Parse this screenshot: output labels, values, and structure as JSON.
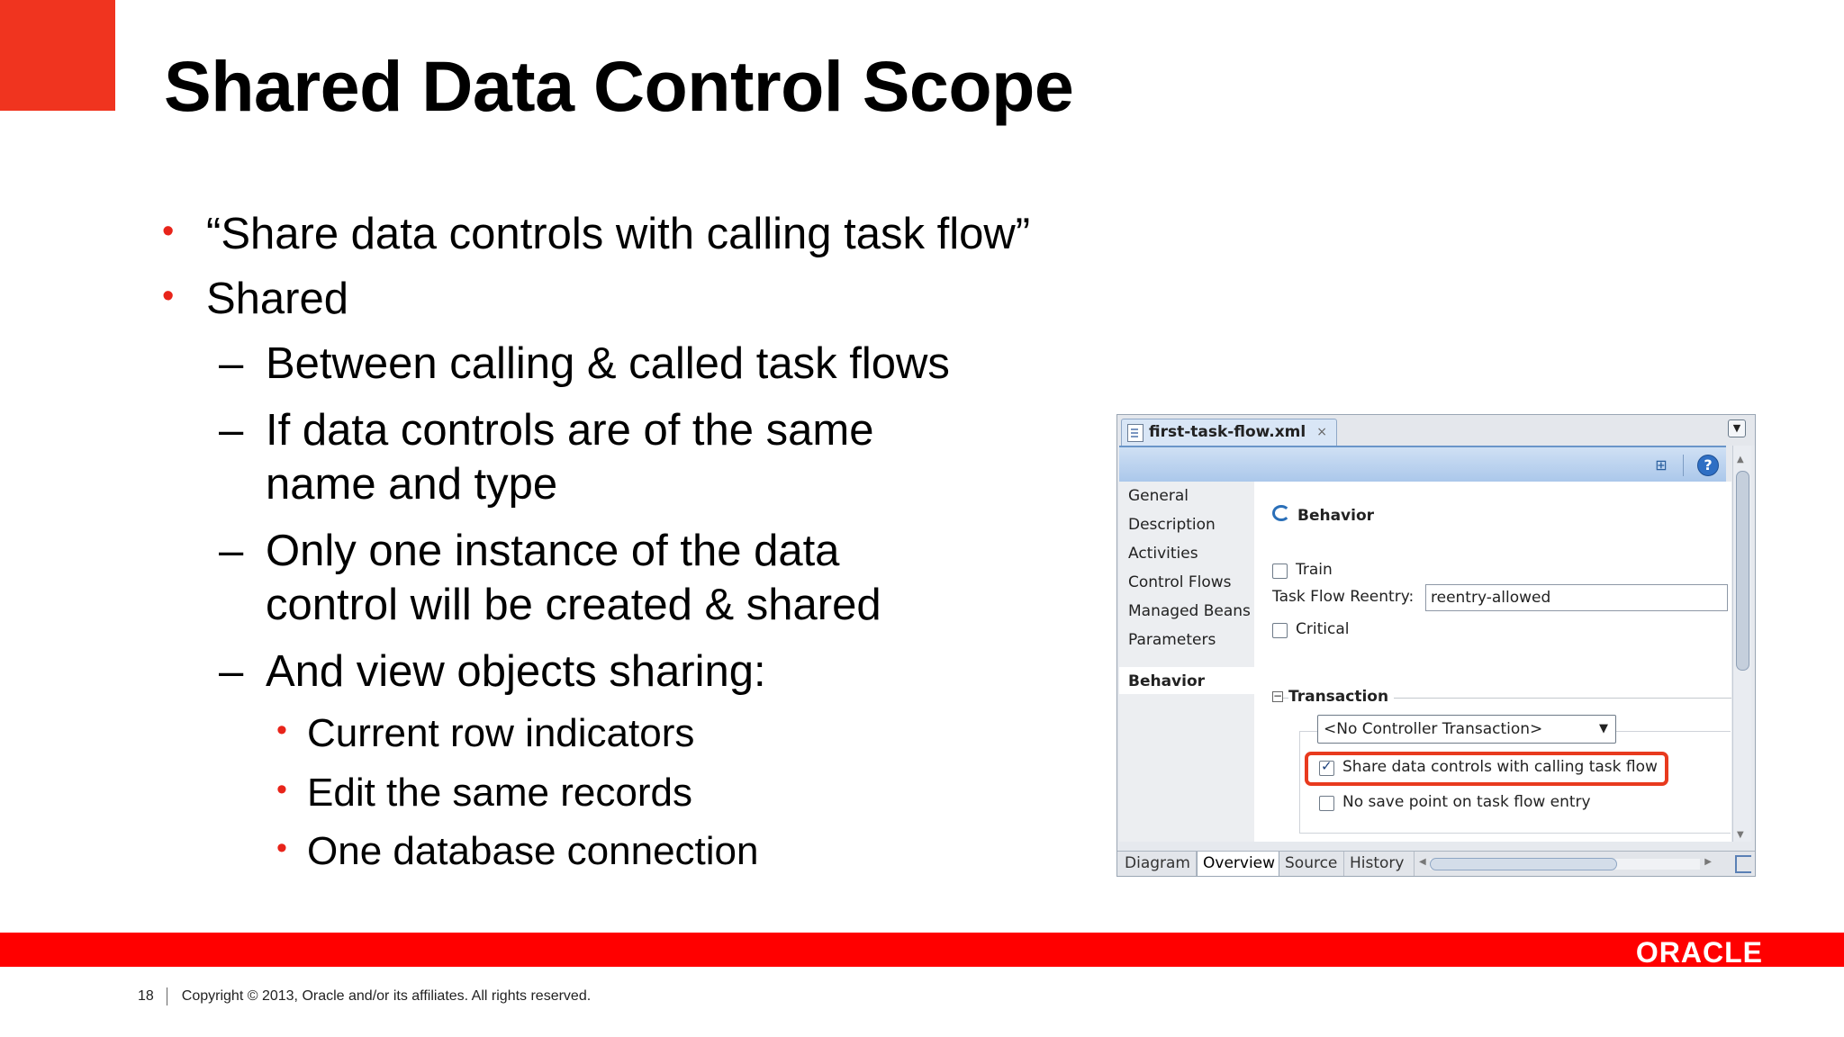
{
  "slide": {
    "title": "Shared Data Control Scope",
    "bullets": {
      "b1": "“Share data controls with calling task flow”",
      "b2": "Shared",
      "s1": "Between calling & called task flows",
      "s2": "If data controls are of the same name and type",
      "s3": "Only one instance of the data control will be created & shared",
      "s4": "And view objects sharing:",
      "t1": "Current row indicators",
      "t2": "Edit the same records",
      "t3": "One database connection"
    },
    "bullet_glyph": "•",
    "dash_glyph": "–",
    "page_number": "18",
    "copyright": "Copyright © 2013, Oracle and/or its affiliates. All rights reserved.",
    "logo": "ORACLE",
    "colors": {
      "accent": "#f0341f",
      "bar": "#ff0000",
      "bullet": "#e8241a"
    }
  },
  "ide": {
    "file_tab": "first-task-flow.xml",
    "tab_close": "×",
    "nav": [
      "General",
      "Description",
      "Activities",
      "Control Flows",
      "Managed Beans",
      "Parameters",
      "Behavior"
    ],
    "section_title": "Behavior",
    "train_label": "Train",
    "reentry_label": "Task Flow Reentry:",
    "reentry_value": "reentry-allowed",
    "critical_label": "Critical",
    "transaction_title": "Transaction",
    "transaction_select": "<No Controller Transaction>",
    "share_label": "Share data controls with calling task flow",
    "share_checked": true,
    "nosave_label": "No save point on task flow entry",
    "nosave_checked": false,
    "bottom_tabs": [
      "Diagram",
      "Overview",
      "Source",
      "History"
    ],
    "selected_bottom_tab": "Overview",
    "help_glyph": "?",
    "icons": [
      "file-xml-icon",
      "layout-icon",
      "help-icon",
      "behavior-icon",
      "dropdown-arrow-icon"
    ]
  }
}
